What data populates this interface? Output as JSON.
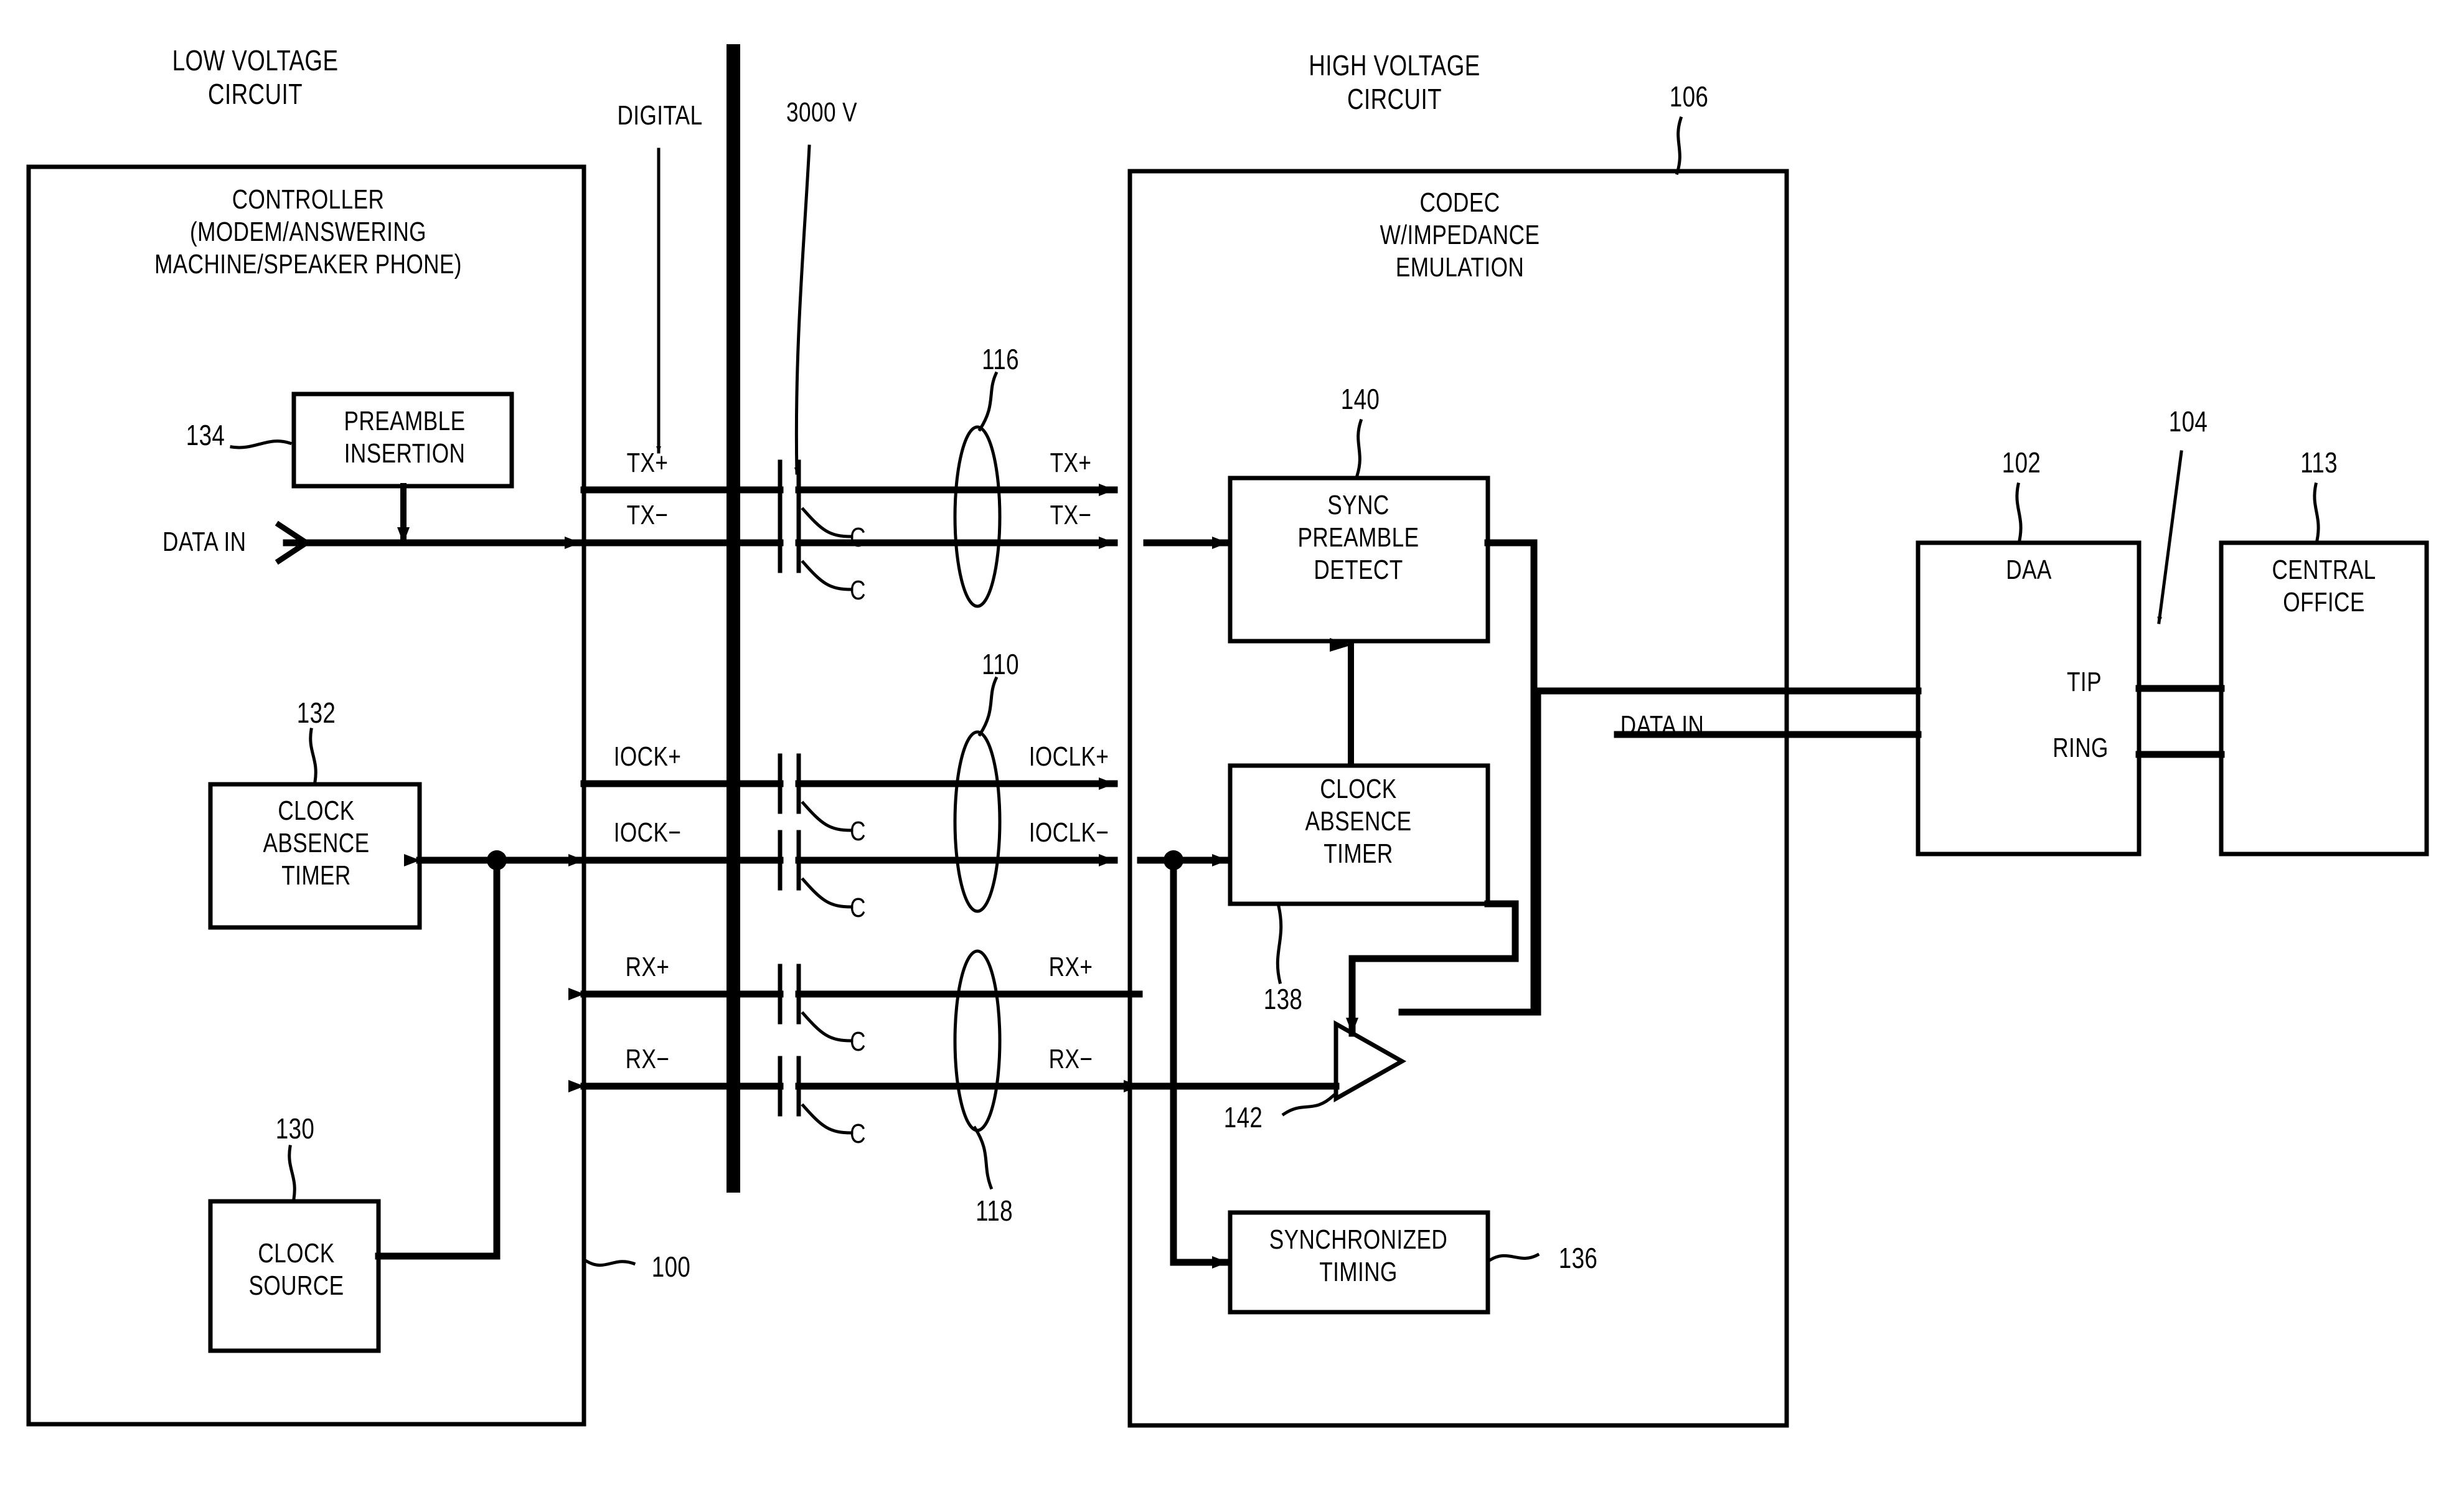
{
  "figure": {
    "kind": "patent-block-diagram",
    "background": "#ffffff",
    "ink": "#000000"
  },
  "headings": {
    "low_voltage": "LOW VOLTAGE\nCIRCUIT",
    "high_voltage": "HIGH VOLTAGE\nCIRCUIT",
    "digital": "DIGITAL",
    "isolation_voltage": "3000 V"
  },
  "boxes": {
    "controller": {
      "label": "CONTROLLER\n(MODEM/ANSWERING\nMACHINE/SPEAKER PHONE)",
      "ref": "100"
    },
    "preamble_insertion": {
      "label": "PREAMBLE\nINSERTION",
      "ref": "134"
    },
    "clock_absence_timer_lv": {
      "label": "CLOCK\nABSENCE\nTIMER",
      "ref": "132"
    },
    "clock_source": {
      "label": "CLOCK\nSOURCE",
      "ref": "130"
    },
    "codec": {
      "label": "CODEC\nW/IMPEDANCE\nEMULATION",
      "ref": "106"
    },
    "sync_preamble_detect": {
      "label": "SYNC\nPREAMBLE\nDETECT",
      "ref": "140"
    },
    "clock_absence_timer_hv": {
      "label": "CLOCK\nABSENCE\nTIMER",
      "ref": "138"
    },
    "synchronized_timing": {
      "label": "SYNCHRONIZED\nTIMING",
      "ref": "136"
    },
    "amplifier": {
      "label": "",
      "ref": "142"
    },
    "daa": {
      "label": "DAA",
      "ref": "102"
    },
    "central_office": {
      "label": "CENTRAL\nOFFICE",
      "ref": "113"
    }
  },
  "ports": {
    "data_in_left": "DATA IN",
    "data_in_right": "DATA IN",
    "tip": "TIP",
    "ring": "RING",
    "line_ref": "104"
  },
  "signals_left": [
    "TX+",
    "TX−",
    "IOCK+",
    "IOCK−",
    "RX+",
    "RX−"
  ],
  "signals_right": [
    "TX+",
    "TX−",
    "IOCLK+",
    "IOCLK−",
    "RX+",
    "RX−"
  ],
  "capacitors": {
    "symbol_label": "C",
    "count": 6,
    "labels": [
      "C",
      "C",
      "C",
      "C",
      "C",
      "C"
    ]
  },
  "cable_bundles": [
    {
      "ref": "116",
      "signals": [
        "TX+",
        "TX−"
      ]
    },
    {
      "ref": "110",
      "signals": [
        "IOCLK+",
        "IOCLK−"
      ]
    },
    {
      "ref": "118",
      "signals": [
        "RX+",
        "RX−"
      ]
    }
  ],
  "reference_numerals": [
    "100",
    "102",
    "104",
    "106",
    "110",
    "113",
    "116",
    "118",
    "130",
    "132",
    "134",
    "136",
    "138",
    "140",
    "142"
  ]
}
